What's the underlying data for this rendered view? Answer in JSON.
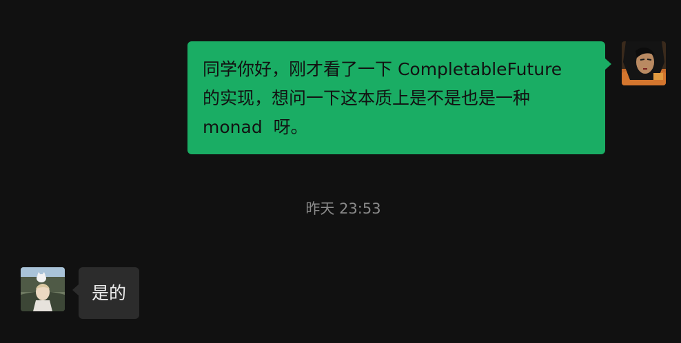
{
  "messages": {
    "outgoing": {
      "lines": [
        "同学你好，刚才看了一下 CompletableFuture",
        "的实现，想问一下这本质上是不是也是一种",
        "monad  呀。"
      ],
      "bubble_color": "#1aad64"
    },
    "timestamp": "昨天 23:53",
    "incoming": {
      "text": "是的",
      "bubble_color": "#2c2c2c"
    }
  },
  "avatars": {
    "self": "anime-woman-avatar",
    "other": "anime-boy-with-cat-avatar"
  },
  "colors": {
    "background": "#111111",
    "timestamp_text": "#8a8a8a"
  }
}
